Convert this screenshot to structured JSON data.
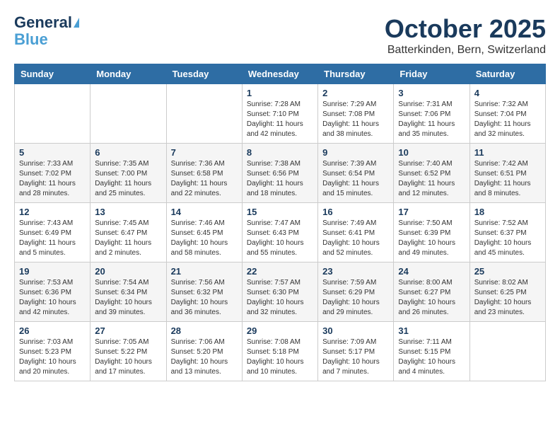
{
  "header": {
    "logo_general": "General",
    "logo_blue": "Blue",
    "month_title": "October 2025",
    "location": "Batterkinden, Bern, Switzerland"
  },
  "days_of_week": [
    "Sunday",
    "Monday",
    "Tuesday",
    "Wednesday",
    "Thursday",
    "Friday",
    "Saturday"
  ],
  "weeks": [
    [
      {
        "day": "",
        "info": ""
      },
      {
        "day": "",
        "info": ""
      },
      {
        "day": "",
        "info": ""
      },
      {
        "day": "1",
        "info": "Sunrise: 7:28 AM\nSunset: 7:10 PM\nDaylight: 11 hours\nand 42 minutes."
      },
      {
        "day": "2",
        "info": "Sunrise: 7:29 AM\nSunset: 7:08 PM\nDaylight: 11 hours\nand 38 minutes."
      },
      {
        "day": "3",
        "info": "Sunrise: 7:31 AM\nSunset: 7:06 PM\nDaylight: 11 hours\nand 35 minutes."
      },
      {
        "day": "4",
        "info": "Sunrise: 7:32 AM\nSunset: 7:04 PM\nDaylight: 11 hours\nand 32 minutes."
      }
    ],
    [
      {
        "day": "5",
        "info": "Sunrise: 7:33 AM\nSunset: 7:02 PM\nDaylight: 11 hours\nand 28 minutes."
      },
      {
        "day": "6",
        "info": "Sunrise: 7:35 AM\nSunset: 7:00 PM\nDaylight: 11 hours\nand 25 minutes."
      },
      {
        "day": "7",
        "info": "Sunrise: 7:36 AM\nSunset: 6:58 PM\nDaylight: 11 hours\nand 22 minutes."
      },
      {
        "day": "8",
        "info": "Sunrise: 7:38 AM\nSunset: 6:56 PM\nDaylight: 11 hours\nand 18 minutes."
      },
      {
        "day": "9",
        "info": "Sunrise: 7:39 AM\nSunset: 6:54 PM\nDaylight: 11 hours\nand 15 minutes."
      },
      {
        "day": "10",
        "info": "Sunrise: 7:40 AM\nSunset: 6:52 PM\nDaylight: 11 hours\nand 12 minutes."
      },
      {
        "day": "11",
        "info": "Sunrise: 7:42 AM\nSunset: 6:51 PM\nDaylight: 11 hours\nand 8 minutes."
      }
    ],
    [
      {
        "day": "12",
        "info": "Sunrise: 7:43 AM\nSunset: 6:49 PM\nDaylight: 11 hours\nand 5 minutes."
      },
      {
        "day": "13",
        "info": "Sunrise: 7:45 AM\nSunset: 6:47 PM\nDaylight: 11 hours\nand 2 minutes."
      },
      {
        "day": "14",
        "info": "Sunrise: 7:46 AM\nSunset: 6:45 PM\nDaylight: 10 hours\nand 58 minutes."
      },
      {
        "day": "15",
        "info": "Sunrise: 7:47 AM\nSunset: 6:43 PM\nDaylight: 10 hours\nand 55 minutes."
      },
      {
        "day": "16",
        "info": "Sunrise: 7:49 AM\nSunset: 6:41 PM\nDaylight: 10 hours\nand 52 minutes."
      },
      {
        "day": "17",
        "info": "Sunrise: 7:50 AM\nSunset: 6:39 PM\nDaylight: 10 hours\nand 49 minutes."
      },
      {
        "day": "18",
        "info": "Sunrise: 7:52 AM\nSunset: 6:37 PM\nDaylight: 10 hours\nand 45 minutes."
      }
    ],
    [
      {
        "day": "19",
        "info": "Sunrise: 7:53 AM\nSunset: 6:36 PM\nDaylight: 10 hours\nand 42 minutes."
      },
      {
        "day": "20",
        "info": "Sunrise: 7:54 AM\nSunset: 6:34 PM\nDaylight: 10 hours\nand 39 minutes."
      },
      {
        "day": "21",
        "info": "Sunrise: 7:56 AM\nSunset: 6:32 PM\nDaylight: 10 hours\nand 36 minutes."
      },
      {
        "day": "22",
        "info": "Sunrise: 7:57 AM\nSunset: 6:30 PM\nDaylight: 10 hours\nand 32 minutes."
      },
      {
        "day": "23",
        "info": "Sunrise: 7:59 AM\nSunset: 6:29 PM\nDaylight: 10 hours\nand 29 minutes."
      },
      {
        "day": "24",
        "info": "Sunrise: 8:00 AM\nSunset: 6:27 PM\nDaylight: 10 hours\nand 26 minutes."
      },
      {
        "day": "25",
        "info": "Sunrise: 8:02 AM\nSunset: 6:25 PM\nDaylight: 10 hours\nand 23 minutes."
      }
    ],
    [
      {
        "day": "26",
        "info": "Sunrise: 7:03 AM\nSunset: 5:23 PM\nDaylight: 10 hours\nand 20 minutes."
      },
      {
        "day": "27",
        "info": "Sunrise: 7:05 AM\nSunset: 5:22 PM\nDaylight: 10 hours\nand 17 minutes."
      },
      {
        "day": "28",
        "info": "Sunrise: 7:06 AM\nSunset: 5:20 PM\nDaylight: 10 hours\nand 13 minutes."
      },
      {
        "day": "29",
        "info": "Sunrise: 7:08 AM\nSunset: 5:18 PM\nDaylight: 10 hours\nand 10 minutes."
      },
      {
        "day": "30",
        "info": "Sunrise: 7:09 AM\nSunset: 5:17 PM\nDaylight: 10 hours\nand 7 minutes."
      },
      {
        "day": "31",
        "info": "Sunrise: 7:11 AM\nSunset: 5:15 PM\nDaylight: 10 hours\nand 4 minutes."
      },
      {
        "day": "",
        "info": ""
      }
    ]
  ]
}
